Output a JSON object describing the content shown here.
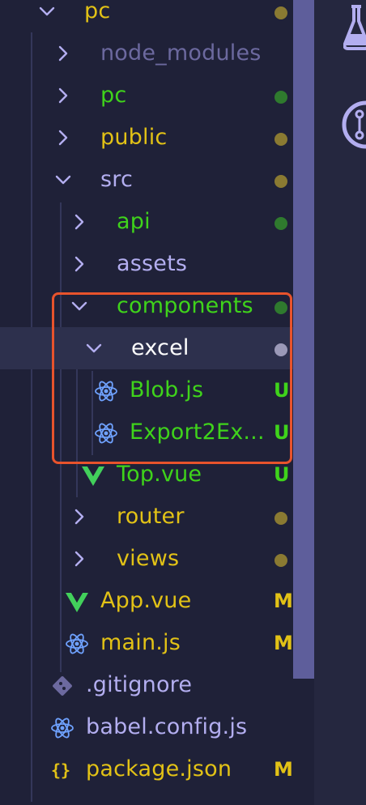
{
  "colors": {
    "sidebar_bg": "#1f2138",
    "untracked_green": "#3fd31b",
    "modified_yellow": "#e2c216",
    "folder_text": "#b3aef0",
    "ignored_text": "#6c699f",
    "dot_green": "#2f7a2e",
    "dot_yellow": "#8a7a32",
    "dot_gray": "#9b99b8",
    "highlight_border": "#e8532c",
    "icon_blue": "#6fa2ff",
    "vue_green": "#42d05b"
  },
  "tree": [
    {
      "label": "pc",
      "kind": "folder",
      "expanded": true,
      "depth": 0,
      "color": "#e2c216",
      "status_dot": "yellow"
    },
    {
      "label": "node_modules",
      "kind": "folder",
      "expanded": false,
      "depth": 1,
      "color": "#6c699f"
    },
    {
      "label": "pc",
      "kind": "folder",
      "expanded": false,
      "depth": 1,
      "color": "#3fd31b",
      "status_dot": "green"
    },
    {
      "label": "public",
      "kind": "folder",
      "expanded": false,
      "depth": 1,
      "color": "#e2c216",
      "status_dot": "yellow"
    },
    {
      "label": "src",
      "kind": "folder",
      "expanded": true,
      "depth": 1,
      "color": "#b3aef0",
      "status_dot": "yellow"
    },
    {
      "label": "api",
      "kind": "folder",
      "expanded": false,
      "depth": 2,
      "color": "#3fd31b",
      "status_dot": "green"
    },
    {
      "label": "assets",
      "kind": "folder",
      "expanded": false,
      "depth": 2,
      "color": "#b3aef0"
    },
    {
      "label": "components",
      "kind": "folder",
      "expanded": true,
      "depth": 2,
      "color": "#3fd31b",
      "status_dot": "green"
    },
    {
      "label": "excel",
      "kind": "folder",
      "expanded": true,
      "depth": 3,
      "color": "#ffffff",
      "status_dot": "gray",
      "selected": true
    },
    {
      "label": "Blob.js",
      "kind": "file",
      "icon": "react-icon",
      "depth": 4,
      "color": "#3fd31b",
      "badge": "U"
    },
    {
      "label": "Export2Ex...",
      "kind": "file",
      "icon": "react-icon",
      "depth": 4,
      "color": "#3fd31b",
      "badge": "U"
    },
    {
      "label": "Top.vue",
      "kind": "file",
      "icon": "vue-icon",
      "depth": 3,
      "color": "#3fd31b",
      "badge": "U"
    },
    {
      "label": "router",
      "kind": "folder",
      "expanded": false,
      "depth": 2,
      "color": "#e2c216",
      "status_dot": "yellow"
    },
    {
      "label": "views",
      "kind": "folder",
      "expanded": false,
      "depth": 2,
      "color": "#e2c216",
      "status_dot": "yellow"
    },
    {
      "label": "App.vue",
      "kind": "file",
      "icon": "vue-icon",
      "depth": 2,
      "color": "#e2c216",
      "badge": "M"
    },
    {
      "label": "main.js",
      "kind": "file",
      "icon": "react-icon",
      "depth": 2,
      "color": "#e2c216",
      "badge": "M"
    },
    {
      "label": ".gitignore",
      "kind": "file",
      "icon": "git-icon",
      "depth": 1,
      "color": "#b3aef0"
    },
    {
      "label": "babel.config.js",
      "kind": "file",
      "icon": "react-icon",
      "depth": 1,
      "color": "#b3aef0"
    },
    {
      "label": "package.json",
      "kind": "file",
      "icon": "json-icon",
      "depth": 1,
      "color": "#e2c216",
      "badge": "M"
    }
  ],
  "activity_bar": [
    {
      "name": "testing-flask-icon"
    },
    {
      "name": "source-control-icon"
    }
  ]
}
